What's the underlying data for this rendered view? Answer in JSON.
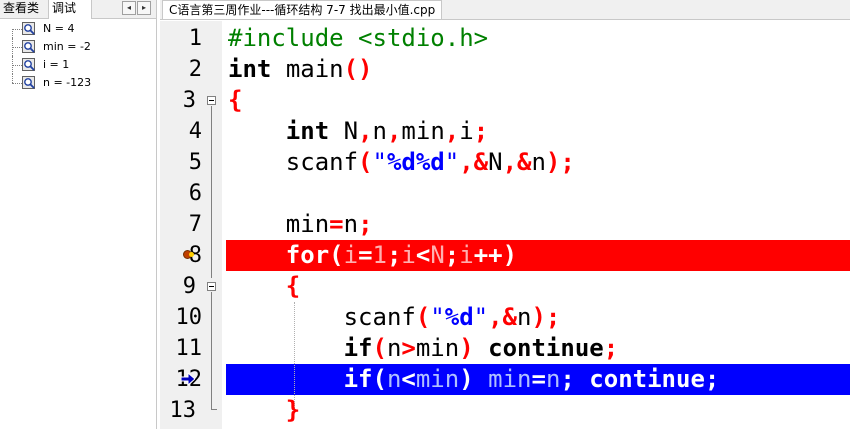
{
  "left_panel": {
    "tabs": [
      {
        "label": "查看类"
      },
      {
        "label": "调试"
      }
    ],
    "scroll_prev": "◂",
    "scroll_next": "▸",
    "watch": [
      {
        "label": "N = 4",
        "icon": "watch-magnifier-icon"
      },
      {
        "label": "min = -2",
        "icon": "watch-magnifier-icon"
      },
      {
        "label": "i = 1",
        "icon": "watch-magnifier-icon"
      },
      {
        "label": "n = -123",
        "icon": "watch-magnifier-icon"
      }
    ]
  },
  "editor": {
    "tab_label": "C语言第三周作业---循环结构 7-7 找出最小值.cpp",
    "line_numbers": [
      "1",
      "2",
      "3",
      "4",
      "5",
      "6",
      "7",
      "8",
      "9",
      "10",
      "11",
      "12",
      "13"
    ],
    "lines": {
      "l1": {
        "a": "#include <stdio.h>"
      },
      "l2": {
        "kw": "int",
        "sp": " ",
        "id": "main",
        "sym": "()"
      },
      "l3": {
        "sym": "{"
      },
      "l4": {
        "ind": "    ",
        "kw": "int",
        "sp": " ",
        "t1": "N",
        "s1": ",",
        "t2": "n",
        "s2": ",",
        "t3": "min",
        "s3": ",",
        "t4": "i",
        "s4": ";"
      },
      "l5": {
        "ind": "    ",
        "id": "scanf",
        "s1": "(",
        "q1": "\"",
        "fmt": "%d%d",
        "q2": "\"",
        "s2": ",&",
        "t1": "N",
        "s3": ",&",
        "t2": "n",
        "s4": ");"
      },
      "l7": {
        "ind": "    ",
        "t1": "min",
        "s1": "=",
        "t2": "n",
        "s2": ";"
      },
      "l8": {
        "ind": "    ",
        "kw": "for",
        "s1": "(",
        "t1": "i",
        "s2": "=",
        "n1": "1",
        "s3": ";",
        "t2": "i",
        "s4": "<",
        "t3": "N",
        "s5": ";",
        "t4": "i",
        "s6": "++)"
      },
      "l9": {
        "ind": "    ",
        "sym": "{"
      },
      "l10": {
        "ind": "        ",
        "id": "scanf",
        "s1": "(",
        "q1": "\"",
        "fmt": "%d",
        "q2": "\"",
        "s2": ",&",
        "t1": "n",
        "s3": ");"
      },
      "l11": {
        "ind": "        ",
        "kw": "if",
        "s1": "(",
        "t1": "n",
        "s2": ">",
        "t2": "min",
        "s3": ")",
        "sp": " ",
        "kw2": "continue",
        "s4": ";"
      },
      "l12": {
        "ind": "        ",
        "kw": "if",
        "s1": "(",
        "t1": "n",
        "s2": "<",
        "t2": "min",
        "s3": ")",
        "sp": " ",
        "t3": "min",
        "s4": "=",
        "t4": "n",
        "s5": ";",
        "sp2": " ",
        "kw2": "continue",
        "s6": ";"
      },
      "l13": {
        "ind": "    ",
        "sym": "}"
      }
    }
  },
  "colors": {
    "breakpoint_line": "#ff0000",
    "execution_line": "#0000ff",
    "keyword": "#000000",
    "symbol": "#ff0000",
    "preprocessor": "#008000",
    "string": "#0000ff"
  }
}
